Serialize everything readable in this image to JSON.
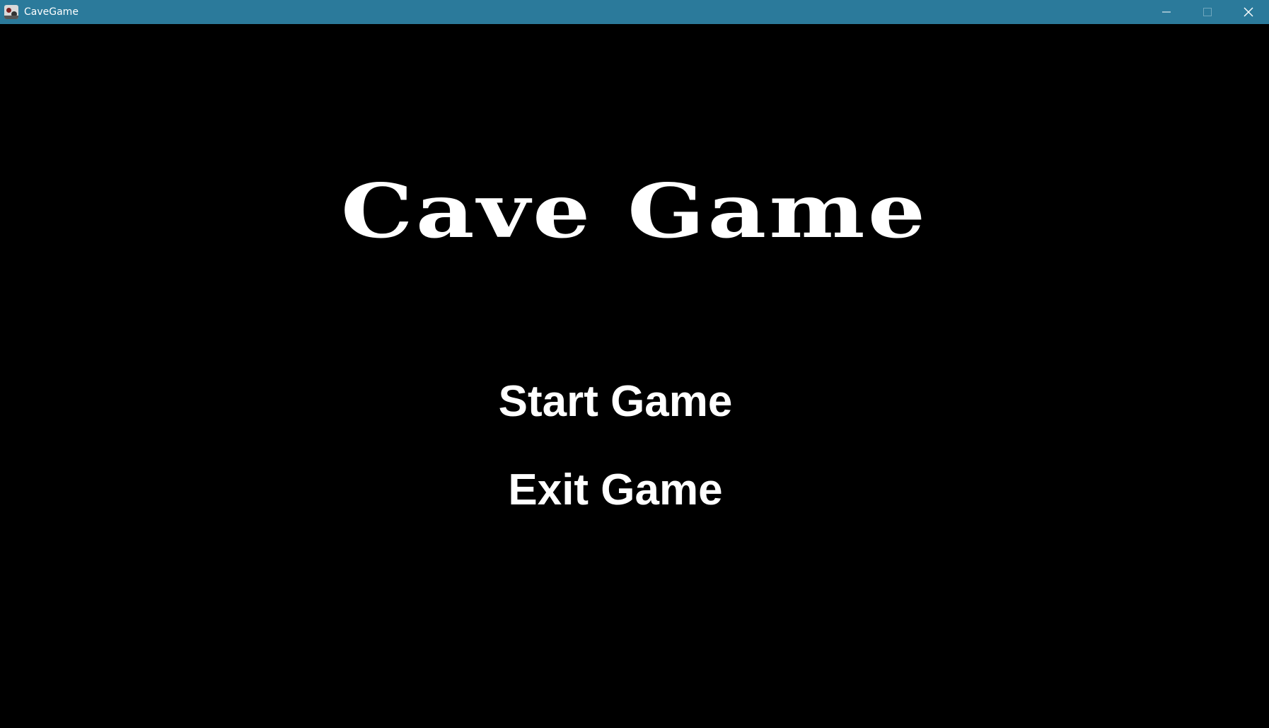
{
  "window": {
    "title": "CaveGame",
    "titlebar_color": "#2b7a9b",
    "icons": {
      "app": "cavegame-app-icon",
      "minimize": "minimize-icon",
      "maximize": "maximize-icon",
      "close": "close-icon"
    }
  },
  "game": {
    "background_color": "#000000",
    "text_color": "#ffffff",
    "title": "Cave Game",
    "menu": {
      "start_label": "Start Game",
      "exit_label": "Exit Game"
    }
  }
}
